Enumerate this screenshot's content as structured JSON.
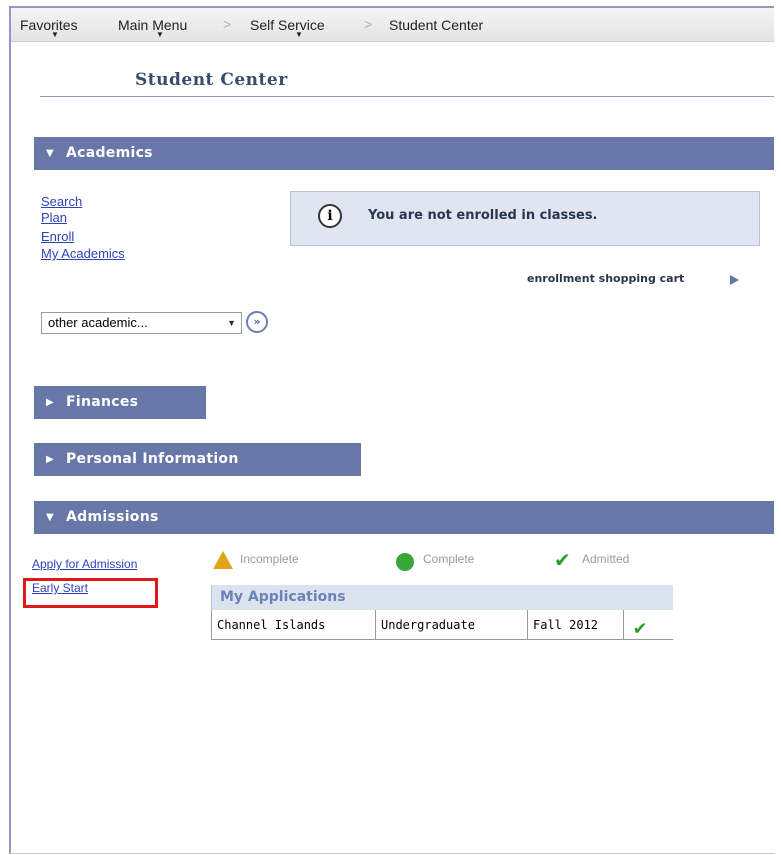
{
  "topnav": {
    "favorites": "Favorites",
    "main_menu": "Main Menu",
    "sep": ">",
    "self_service": "Self Service",
    "student_center": "Student Center"
  },
  "page_title": "Student Center",
  "academics": {
    "header": "Academics",
    "links": [
      "Search",
      "Plan",
      "Enroll",
      "My Academics"
    ],
    "notice": "You are not enrolled in classes.",
    "cart_link": "enrollment shopping cart",
    "select_value": "other academic...",
    "go_label": "»"
  },
  "finances": {
    "header": "Finances"
  },
  "personal_info": {
    "header": "Personal Information"
  },
  "admissions": {
    "header": "Admissions",
    "apply_link": "Apply for Admission",
    "early_start_link": "Early Start",
    "legend": {
      "incomplete": "Incomplete",
      "complete": "Complete",
      "admitted": "Admitted"
    },
    "table_title": "My Applications",
    "rows": [
      {
        "campus": "Channel Islands",
        "level": "Undergraduate",
        "term": "Fall 2012",
        "status": "admitted"
      }
    ]
  },
  "icons": {
    "section_expanded": "triangle-down",
    "section_collapsed": "triangle-right",
    "info": "info-icon",
    "warning": "warning-icon",
    "complete": "complete-icon",
    "admitted": "check-icon"
  },
  "colors": {
    "section_bar": "#6777a8",
    "link": "#2d43b8",
    "highlight": "#e01818",
    "admitted": "#2e9a2e",
    "warning": "#e2a21a"
  }
}
